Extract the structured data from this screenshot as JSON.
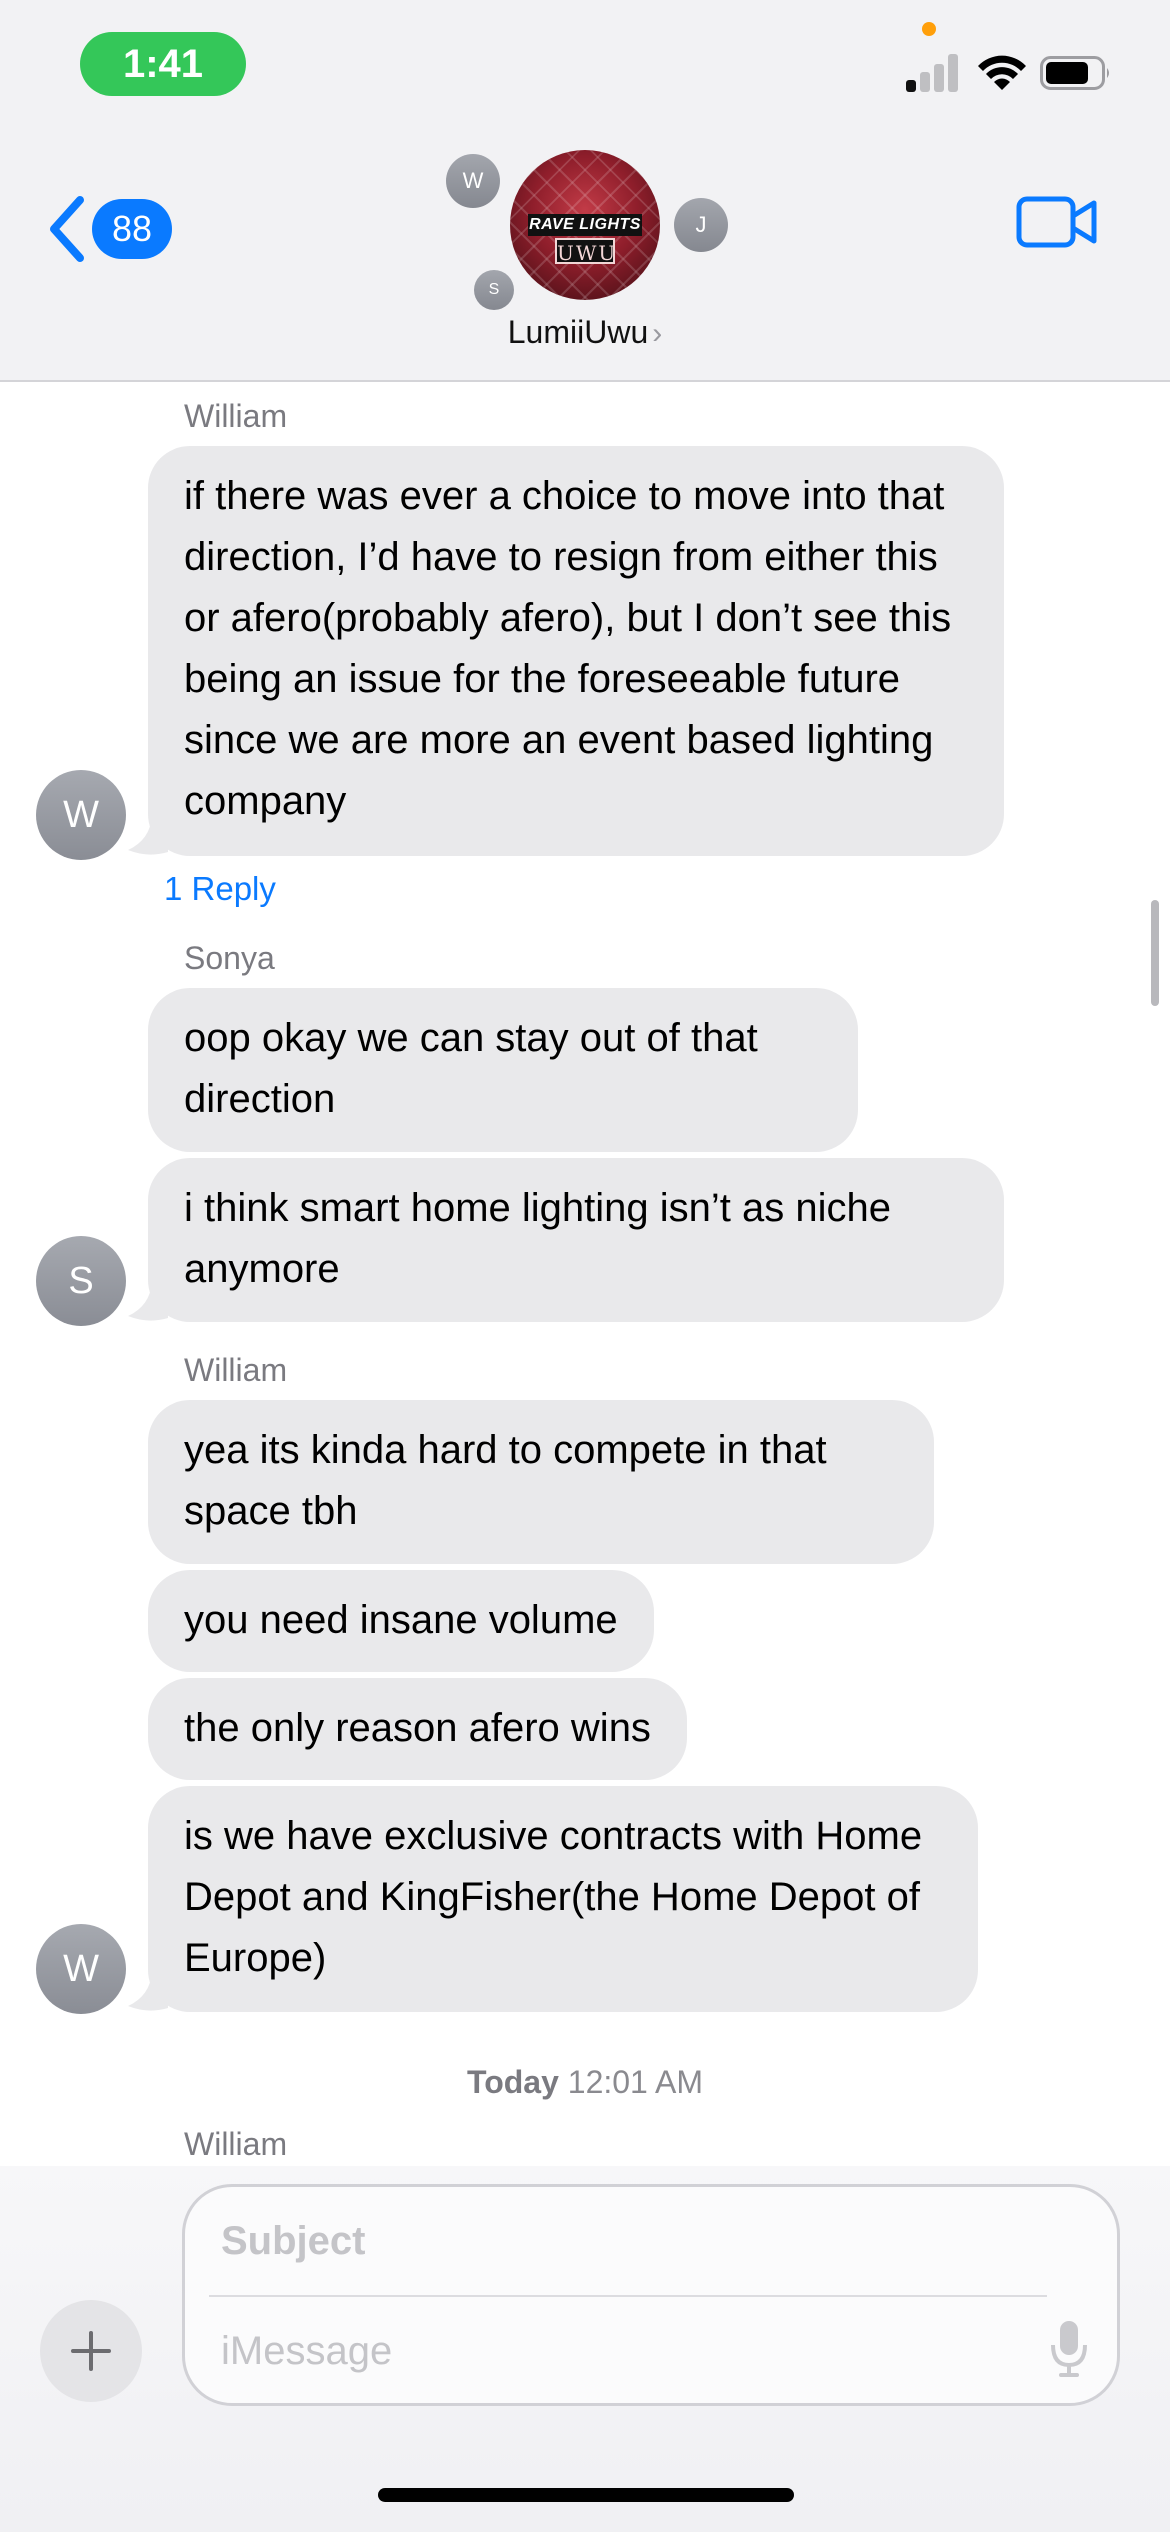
{
  "status_bar": {
    "time": "1:41"
  },
  "header": {
    "back_count": "88",
    "contact_name": "LumiiUwu",
    "chevron": "›",
    "group_avatar_text_line1": "RAVE LIGHTS",
    "group_avatar_text_line2": "UWU",
    "member_initials": {
      "w": "W",
      "j": "J",
      "s": "S"
    }
  },
  "messages": {
    "group1": {
      "sender": "William",
      "avatar": "W",
      "bubbles": [
        "if there was ever a choice to move into that direction, I’d have to resign from either this or afero(probably afero), but I don’t see this being an issue for the foreseeable future since we are more an event based lighting company"
      ],
      "reply_link": "1 Reply"
    },
    "group2": {
      "sender": "Sonya",
      "avatar": "S",
      "bubbles": [
        "oop okay we can stay out of that direction",
        "i think smart home lighting isn’t as niche anymore"
      ]
    },
    "group3": {
      "sender": "William",
      "avatar": "W",
      "bubbles": [
        "yea its kinda hard to compete in that space tbh",
        "you need insane volume",
        "the only reason afero wins",
        "is we have exclusive contracts with Home Depot and KingFisher(the Home Depot of Europe)"
      ]
    },
    "timestamp_day": "Today",
    "timestamp_time": "12:01 AM",
    "group4": {
      "sender": "William"
    }
  },
  "compose": {
    "plus": "+",
    "subject_placeholder": "Subject",
    "message_placeholder": "iMessage"
  },
  "colors": {
    "accent": "#0a7aff",
    "status_pill": "#34c759",
    "bubble_received": "#e9e9eb"
  }
}
